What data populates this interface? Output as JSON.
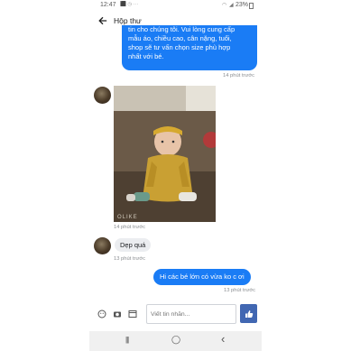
{
  "status_bar": {
    "time": "12:47",
    "left_icons": "⬛ ◷ ···",
    "battery": "23%"
  },
  "header": {
    "title": "Hộp thư"
  },
  "messages": {
    "outgoing_top": {
      "lines": [
        "tin cho chúng tôi. Vui lòng cung cấp",
        "mẫu áo, chiều cao, cân nặng, tuổi,",
        "shop sẽ tư vấn chọn size phù hợp",
        "nhất với bé."
      ],
      "time": "14 phút trước"
    },
    "incoming_photo": {
      "watermark": "OLIKE",
      "time": "14 phút trước"
    },
    "incoming_text": {
      "text": "Dẹp quá",
      "time": "13 phút trước"
    },
    "outgoing_bottom": {
      "text": "Hi các bé lớn có vừa ko c ơi",
      "time": "13 phút trước"
    }
  },
  "composer": {
    "placeholder": "Viết tin nhắn..."
  },
  "nav_bar": {
    "recents": "|||",
    "home": "◯",
    "back": "‹"
  },
  "colors": {
    "outgoing_bubble": "#1a7cf5",
    "send_button": "#4167b2",
    "incoming_bubble": "#ebedf0"
  }
}
